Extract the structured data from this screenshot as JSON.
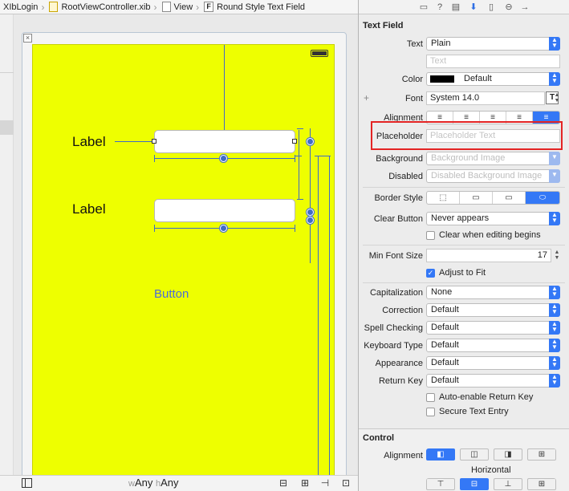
{
  "breadcrumb": {
    "items": [
      {
        "label": "XIbLogin"
      },
      {
        "label": "RootViewController.xib"
      },
      {
        "label": "View"
      },
      {
        "label": "Round Style Text Field",
        "icon_letter": "F"
      }
    ]
  },
  "canvas": {
    "label1": "Label",
    "label2": "Label",
    "button": "Button"
  },
  "bottombar": {
    "width_key": "w",
    "width_value": "Any",
    "height_key": "h",
    "height_value": "Any"
  },
  "inspector": {
    "section_title": "Text Field",
    "text_label": "Text",
    "text_value": "Plain",
    "text_placeholder": "Text",
    "color_label": "Color",
    "color_value": "Default",
    "font_label": "Font",
    "font_value": "System 14.0",
    "font_button": "T",
    "alignment_label": "Alignment",
    "placeholder_label": "Placeholder",
    "placeholder_hint": "Placeholder Text",
    "background_label": "Background",
    "background_hint": "Background Image",
    "disabled_label": "Disabled",
    "disabled_hint": "Disabled Background Image",
    "border_style_label": "Border Style",
    "clear_button_label": "Clear Button",
    "clear_button_value": "Never appears",
    "clear_when_editing": "Clear when editing begins",
    "min_font_label": "Min Font Size",
    "min_font_value": "17",
    "adjust_to_fit": "Adjust to Fit",
    "capitalization_label": "Capitalization",
    "capitalization_value": "None",
    "correction_label": "Correction",
    "correction_value": "Default",
    "spell_label": "Spell Checking",
    "spell_value": "Default",
    "keyboard_label": "Keyboard Type",
    "keyboard_value": "Default",
    "appearance_label": "Appearance",
    "appearance_value": "Default",
    "return_label": "Return Key",
    "return_value": "Default",
    "auto_enable": "Auto-enable Return Key",
    "secure": "Secure Text Entry",
    "control_title": "Control",
    "control_alignment_label": "Alignment",
    "horizontal_label": "Horizontal"
  },
  "colors": {
    "canvas_view": "#eeff00",
    "accent": "#3478f6",
    "constraint": "#3f6bc6",
    "highlight": "#e32424"
  }
}
